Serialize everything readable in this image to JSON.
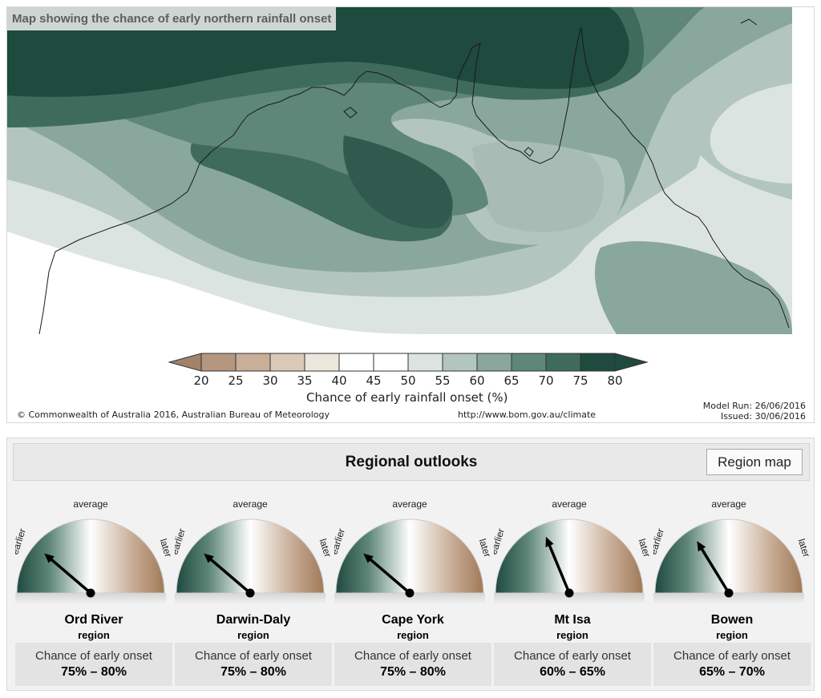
{
  "map": {
    "title": "Map showing the chance of early northern rainfall onset",
    "colorbar_title": "Chance of early rainfall onset (%)",
    "colorbar_ticks": [
      "20",
      "25",
      "30",
      "35",
      "40",
      "45",
      "50",
      "55",
      "60",
      "65",
      "70",
      "75",
      "80"
    ],
    "colorbar_colors": [
      "#a0836a",
      "#b5967e",
      "#c9ae98",
      "#dbc8b6",
      "#ece6dd",
      "#ffffff",
      "#ffffff",
      "#dce4e1",
      "#b3c5bf",
      "#8aa79d",
      "#5e8679",
      "#3f6b5d",
      "#1f4a3e"
    ],
    "copyright": "© Commonwealth of Australia 2016, Australian Bureau of Meteorology",
    "url": "http://www.bom.gov.au/climate",
    "model_run": "Model Run: 26/06/2016",
    "issued": "Issued: 30/06/2016"
  },
  "outlooks": {
    "title": "Regional outlooks",
    "region_map_button": "Region map",
    "gauge_labels": {
      "average": "average",
      "earlier": "earlier",
      "later": "later"
    },
    "region_suffix": "region",
    "chance_label": "Chance of early onset",
    "regions": [
      {
        "name": "Ord River",
        "chance": "75% – 80%",
        "needle_chance": 77.5
      },
      {
        "name": "Darwin-Daly",
        "chance": "75% – 80%",
        "needle_chance": 77.5
      },
      {
        "name": "Cape York",
        "chance": "75% – 80%",
        "needle_chance": 77.5
      },
      {
        "name": "Mt Isa",
        "chance": "60% – 65%",
        "needle_chance": 62.5
      },
      {
        "name": "Bowen",
        "chance": "65% – 70%",
        "needle_chance": 67.5
      }
    ]
  }
}
